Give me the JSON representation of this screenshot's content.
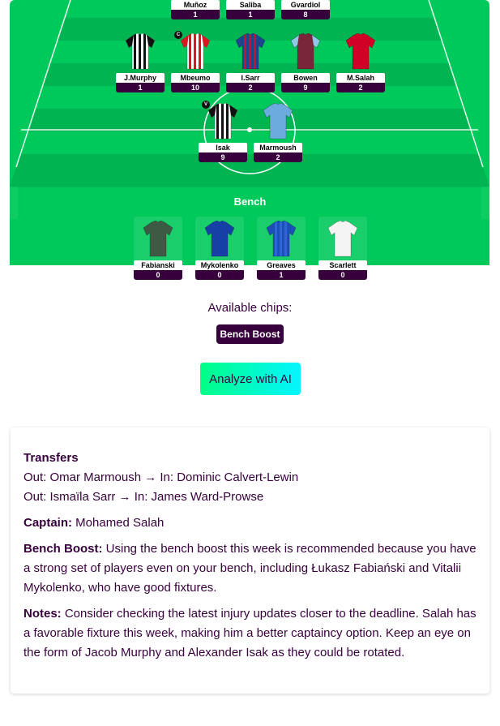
{
  "pitch": {
    "bench_label": "Bench",
    "top_row": [
      {
        "name": "Muñoz",
        "points": "1",
        "shirt": "stripes-redwhite"
      },
      {
        "name": "Saliba",
        "points": "1",
        "shirt": "red"
      },
      {
        "name": "Gvardiol",
        "points": "8",
        "shirt": "skyblue"
      }
    ],
    "midfield": [
      {
        "name": "J.Murphy",
        "points": "1",
        "shirt": "stripes-bw",
        "badge": ""
      },
      {
        "name": "Mbeumo",
        "points": "10",
        "shirt": "stripes-redwhite",
        "badge": "C"
      },
      {
        "name": "I.Sarr",
        "points": "2",
        "shirt": "stripes-redblue",
        "badge": ""
      },
      {
        "name": "Bowen",
        "points": "9",
        "shirt": "claret",
        "badge": ""
      },
      {
        "name": "M.Salah",
        "points": "2",
        "shirt": "red",
        "badge": ""
      }
    ],
    "forwards": [
      {
        "name": "Isak",
        "points": "9",
        "shirt": "stripes-bw",
        "badge": "V"
      },
      {
        "name": "Marmoush",
        "points": "2",
        "shirt": "skyblue",
        "badge": ""
      }
    ],
    "bench": [
      {
        "name": "Fabianski",
        "points": "0",
        "shirt": "gk-green"
      },
      {
        "name": "Mykolenko",
        "points": "0",
        "shirt": "blue"
      },
      {
        "name": "Greaves",
        "points": "1",
        "shirt": "pinstripe-blue"
      },
      {
        "name": "Scarlett",
        "points": "0",
        "shirt": "white"
      }
    ]
  },
  "chips": {
    "label": "Available chips:",
    "items": [
      "Bench Boost"
    ]
  },
  "analyze_label": "Analyze with AI",
  "analysis": {
    "transfers_title": "Transfers",
    "transfers": [
      "Out: Omar Marmoush → In: Dominic Calvert-Lewin",
      "Out: Ismaïla Sarr → In: James Ward-Prowse"
    ],
    "captain_label": "Captain:",
    "captain_value": " Mohamed Salah",
    "bench_boost_label": "Bench Boost:",
    "bench_boost_text": " Using the bench boost this week is recommended because you have a strong set of players even on your bench, including Łukasz Fabiański and Vitalii Mykolenko, who have good fixtures.",
    "notes_label": "Notes:",
    "notes_text": " Consider checking the latest injury updates closer to the deadline. Salah has a favorable fixture this week, making him a better captaincy option. Keep an eye on the form of Jacob Murphy and Alexander Isak as they could be rotated."
  },
  "colors": {
    "pitch_light": "#00c95b",
    "pitch_dark": "#00b451",
    "purple": "#37003c",
    "accent_green": "#00ff87",
    "accent_cyan": "#04f5ff"
  }
}
